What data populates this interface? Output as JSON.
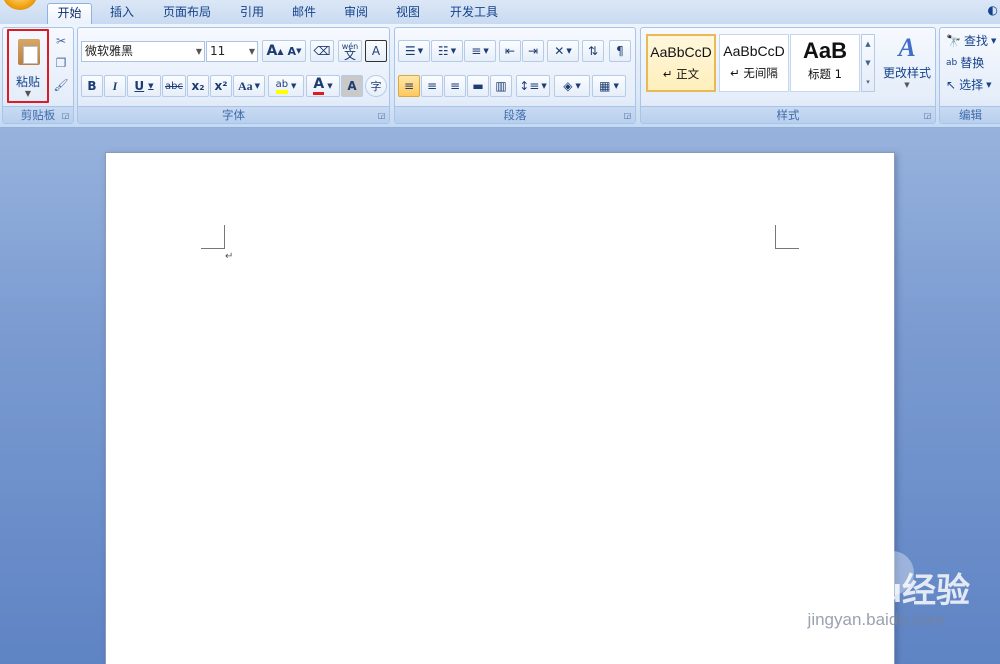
{
  "tabs": [
    "开始",
    "插入",
    "页面布局",
    "引用",
    "邮件",
    "审阅",
    "视图",
    "开发工具"
  ],
  "active_tab": "开始",
  "groups": {
    "clipboard": "剪贴板",
    "font": "字体",
    "paragraph": "段落",
    "styles": "样式",
    "editing": "编辑"
  },
  "clipboard": {
    "paste_label": "粘贴"
  },
  "font": {
    "name": "微软雅黑",
    "size": "11",
    "grow": "A",
    "shrink": "A",
    "bold": "B",
    "italic": "I",
    "underline": "U",
    "strike": "abc",
    "subscript": "x₂",
    "superscript": "x²",
    "change_case": "Aa",
    "phonetic_top": "wén",
    "phonetic_bottom": "文",
    "border_char": "A",
    "highlight": "ab",
    "font_color": "A",
    "shade_char": "A",
    "enclose_char": "字"
  },
  "styles": {
    "items": [
      {
        "sample": "AaBbCcD",
        "name": "↵ 正文"
      },
      {
        "sample": "AaBbCcD",
        "name": "↵ 无间隔"
      },
      {
        "sample": "AaB",
        "name": "标题 1"
      }
    ],
    "change_style_icon": "A",
    "change_style_label": "更改样式"
  },
  "editing": {
    "find": "查找",
    "replace": "替换",
    "select": "选择"
  },
  "document": {
    "paragraph_mark": "↵"
  },
  "watermark": {
    "brand": "Baidu经验",
    "url": "jingyan.baidu.com"
  },
  "colors": {
    "highlight_red": "#e01a22",
    "ribbon_text": "#15428b"
  }
}
